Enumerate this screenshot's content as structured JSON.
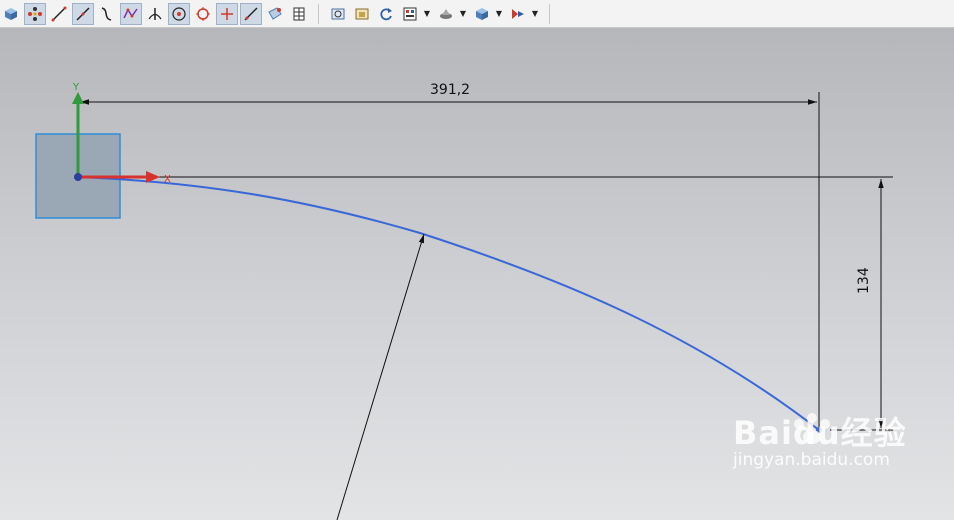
{
  "toolbar": {
    "icons": [
      "view-cube-icon",
      "snap-points-icon",
      "line-icon",
      "line-active-icon",
      "arc-icon",
      "studio-spline-icon",
      "perpendicular-icon",
      "point-on-curve-icon",
      "circle-icon",
      "point-icon",
      "line-tangent-icon",
      "surface-icon",
      "table-icon",
      "zoom-fit-icon",
      "view-orient-icon",
      "refresh-icon",
      "layer-icon",
      "shade-icon",
      "block-icon",
      "snap-view-icon"
    ]
  },
  "sketch": {
    "axes": {
      "x_label": "X",
      "y_label": "Y"
    },
    "dimension_horizontal": "391,2",
    "dimension_vertical": "134"
  },
  "watermark": {
    "logo": "Baidu经验",
    "url": "jingyan.baidu.com"
  },
  "colors": {
    "curve": "#3a67d8",
    "x_axis": "#d8322d",
    "y_axis": "#2f9b3a",
    "plane_fill": "#9aa7b4",
    "plane_border": "#2f8fd8"
  }
}
